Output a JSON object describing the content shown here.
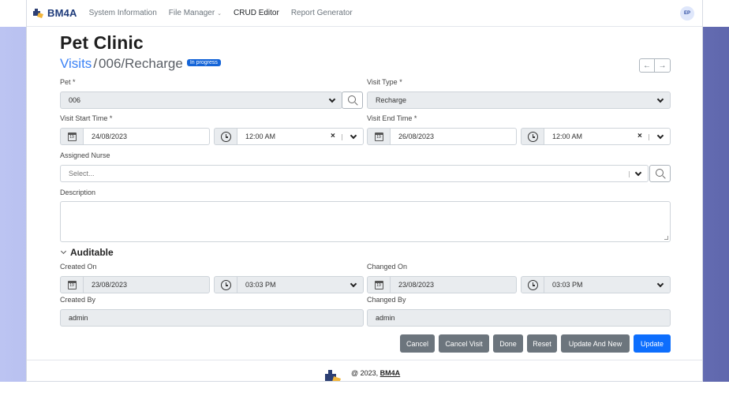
{
  "nav": {
    "brand": "BM4A",
    "items": [
      {
        "label": "System Information",
        "active": false
      },
      {
        "label": "File Manager",
        "active": false,
        "dropdown": true
      },
      {
        "label": "CRUD Editor",
        "active": true
      },
      {
        "label": "Report Generator",
        "active": false
      }
    ],
    "avatar": "EP"
  },
  "page": {
    "title": "Pet Clinic",
    "breadcrumb_link": "Visits",
    "breadcrumb_separator": "/",
    "breadcrumb_rest": "006/Recharge",
    "status_badge": "In progress",
    "prev_icon": "←",
    "next_icon": "→"
  },
  "form": {
    "pet": {
      "label": "Pet *",
      "value": "006"
    },
    "visit_type": {
      "label": "Visit Type *",
      "value": "Recharge"
    },
    "visit_start": {
      "label": "Visit Start Time *",
      "date": "24/08/2023",
      "time": "12:00 AM"
    },
    "visit_end": {
      "label": "Visit End Time *",
      "date": "26/08/2023",
      "time": "12:00 AM"
    },
    "assigned_nurse": {
      "label": "Assigned Nurse",
      "placeholder": "Select..."
    },
    "description": {
      "label": "Description",
      "value": ""
    },
    "calendar_icon_text": "19",
    "clear_glyph": "×"
  },
  "auditable": {
    "title": "Auditable",
    "created_on": {
      "label": "Created On",
      "date": "23/08/2023",
      "time": "03:03 PM"
    },
    "changed_on": {
      "label": "Changed On",
      "date": "23/08/2023",
      "time": "03:03 PM"
    },
    "created_by": {
      "label": "Created By",
      "value": "admin"
    },
    "changed_by": {
      "label": "Changed By",
      "value": "admin"
    }
  },
  "actions": {
    "cancel": "Cancel",
    "cancel_visit": "Cancel Visit",
    "done": "Done",
    "reset": "Reset",
    "update_and_new": "Update And New",
    "update": "Update"
  },
  "footer": {
    "prefix": "@ 2023, ",
    "link": "BM4A"
  },
  "colors": {
    "accent": "#0d6efd",
    "secondary": "#6c757d",
    "brand": "#1d3a7a",
    "badge": "#1565d8"
  }
}
